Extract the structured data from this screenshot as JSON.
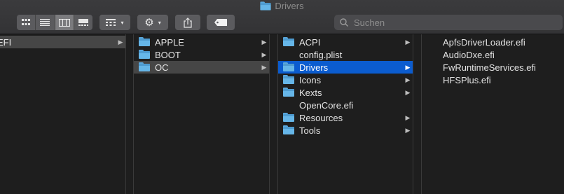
{
  "window": {
    "title": "Drivers"
  },
  "toolbar": {
    "view_modes": [
      "icon-view",
      "list-view",
      "column-view",
      "gallery-view"
    ],
    "active_view": "column-view",
    "group_button": "group-by-icon",
    "action_button": "gear-icon",
    "share_button": "share-icon",
    "tags_button": "tag-icon"
  },
  "search": {
    "placeholder": "Suchen"
  },
  "columns": [
    {
      "items": [
        {
          "label": "EFI",
          "type": "folder",
          "has_children": true,
          "selected": "gray"
        }
      ]
    },
    {
      "items": [
        {
          "label": "APPLE",
          "type": "folder",
          "has_children": true
        },
        {
          "label": "BOOT",
          "type": "folder",
          "has_children": true
        },
        {
          "label": "OC",
          "type": "folder",
          "has_children": true,
          "selected": "gray"
        }
      ]
    },
    {
      "items": [
        {
          "label": "ACPI",
          "type": "folder",
          "has_children": true
        },
        {
          "label": "config.plist",
          "type": "plist",
          "has_children": false
        },
        {
          "label": "Drivers",
          "type": "folder",
          "has_children": true,
          "selected": "blue"
        },
        {
          "label": "Icons",
          "type": "folder",
          "has_children": true
        },
        {
          "label": "Kexts",
          "type": "folder",
          "has_children": true
        },
        {
          "label": "OpenCore.efi",
          "type": "file",
          "has_children": false
        },
        {
          "label": "Resources",
          "type": "folder",
          "has_children": true
        },
        {
          "label": "Tools",
          "type": "folder",
          "has_children": true
        }
      ]
    },
    {
      "items": [
        {
          "label": "ApfsDriverLoader.efi",
          "type": "file",
          "has_children": false
        },
        {
          "label": "AudioDxe.efi",
          "type": "file",
          "has_children": false
        },
        {
          "label": "FwRuntimeServices.efi",
          "type": "file",
          "has_children": false
        },
        {
          "label": "HFSPlus.efi",
          "type": "file",
          "has_children": false
        }
      ]
    }
  ],
  "colors": {
    "selection_blue": "#0b5ccf",
    "selection_gray": "#464646",
    "folder": "#66b6e8"
  }
}
